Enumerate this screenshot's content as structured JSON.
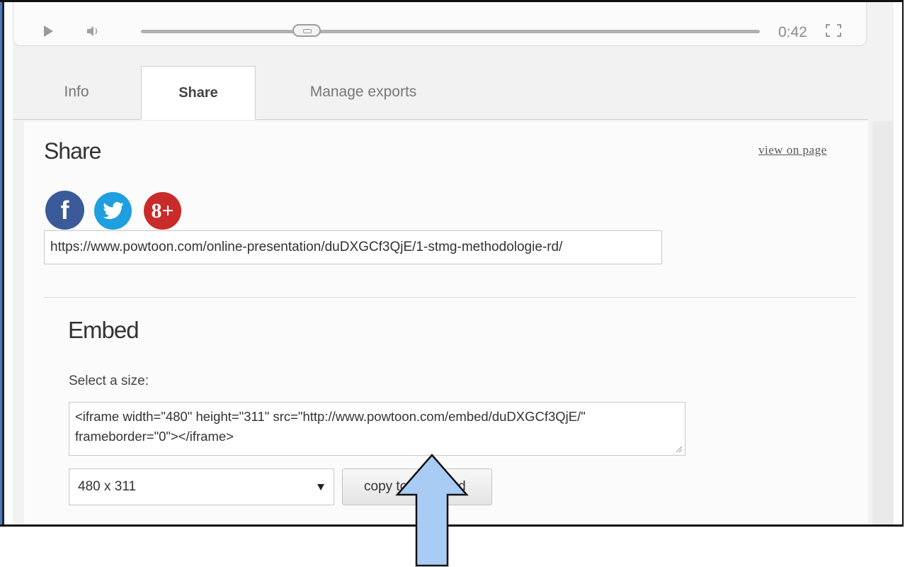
{
  "player": {
    "time": "0:42",
    "progress_fraction": 0.27
  },
  "tabs": [
    {
      "label": "Info"
    },
    {
      "label": "Share"
    },
    {
      "label": "Manage exports"
    }
  ],
  "share": {
    "title": "Share",
    "view_link": "view on page",
    "social": [
      {
        "icon": "facebook-icon",
        "glyph": "f",
        "color": "#3b5a99"
      },
      {
        "icon": "twitter-icon",
        "glyph": "",
        "color": "#1d9fe0"
      },
      {
        "icon": "google-plus-icon",
        "glyph": "8+",
        "color": "#c92a2a"
      }
    ],
    "url": "https://www.powtoon.com/online-presentation/duDXGCf3QjE/1-stmg-methodologie-rd/"
  },
  "embed": {
    "title": "Embed",
    "size_label": "Select a size:",
    "code": "<iframe width=\"480\" height=\"311\" src=\"http://www.powtoon.com/embed/duDXGCf3QjE/\" frameborder=\"0\"></iframe>",
    "selected_size": "480 x 311",
    "copy_label": "copy to clipboard"
  },
  "annotation": {
    "arrow_color": "#a9ccf5"
  }
}
